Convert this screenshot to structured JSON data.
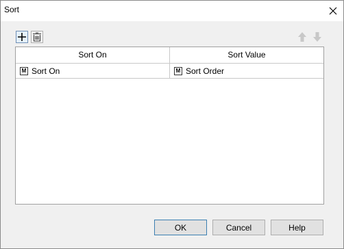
{
  "window": {
    "title": "Sort"
  },
  "toolbar": {
    "add_icon": "plus-icon",
    "delete_icon": "trash-icon",
    "up_icon": "arrow-up-icon",
    "down_icon": "arrow-down-icon"
  },
  "table": {
    "columns": [
      "Sort On",
      "Sort Value"
    ],
    "rows": [
      {
        "sort_on": "Sort On",
        "sort_value": "Sort Order",
        "icon_label": "M"
      }
    ]
  },
  "buttons": {
    "ok": "OK",
    "cancel": "Cancel",
    "help": "Help"
  },
  "colors": {
    "accent": "#3c7fb1",
    "disabled_arrow": "#c8c8c8"
  }
}
